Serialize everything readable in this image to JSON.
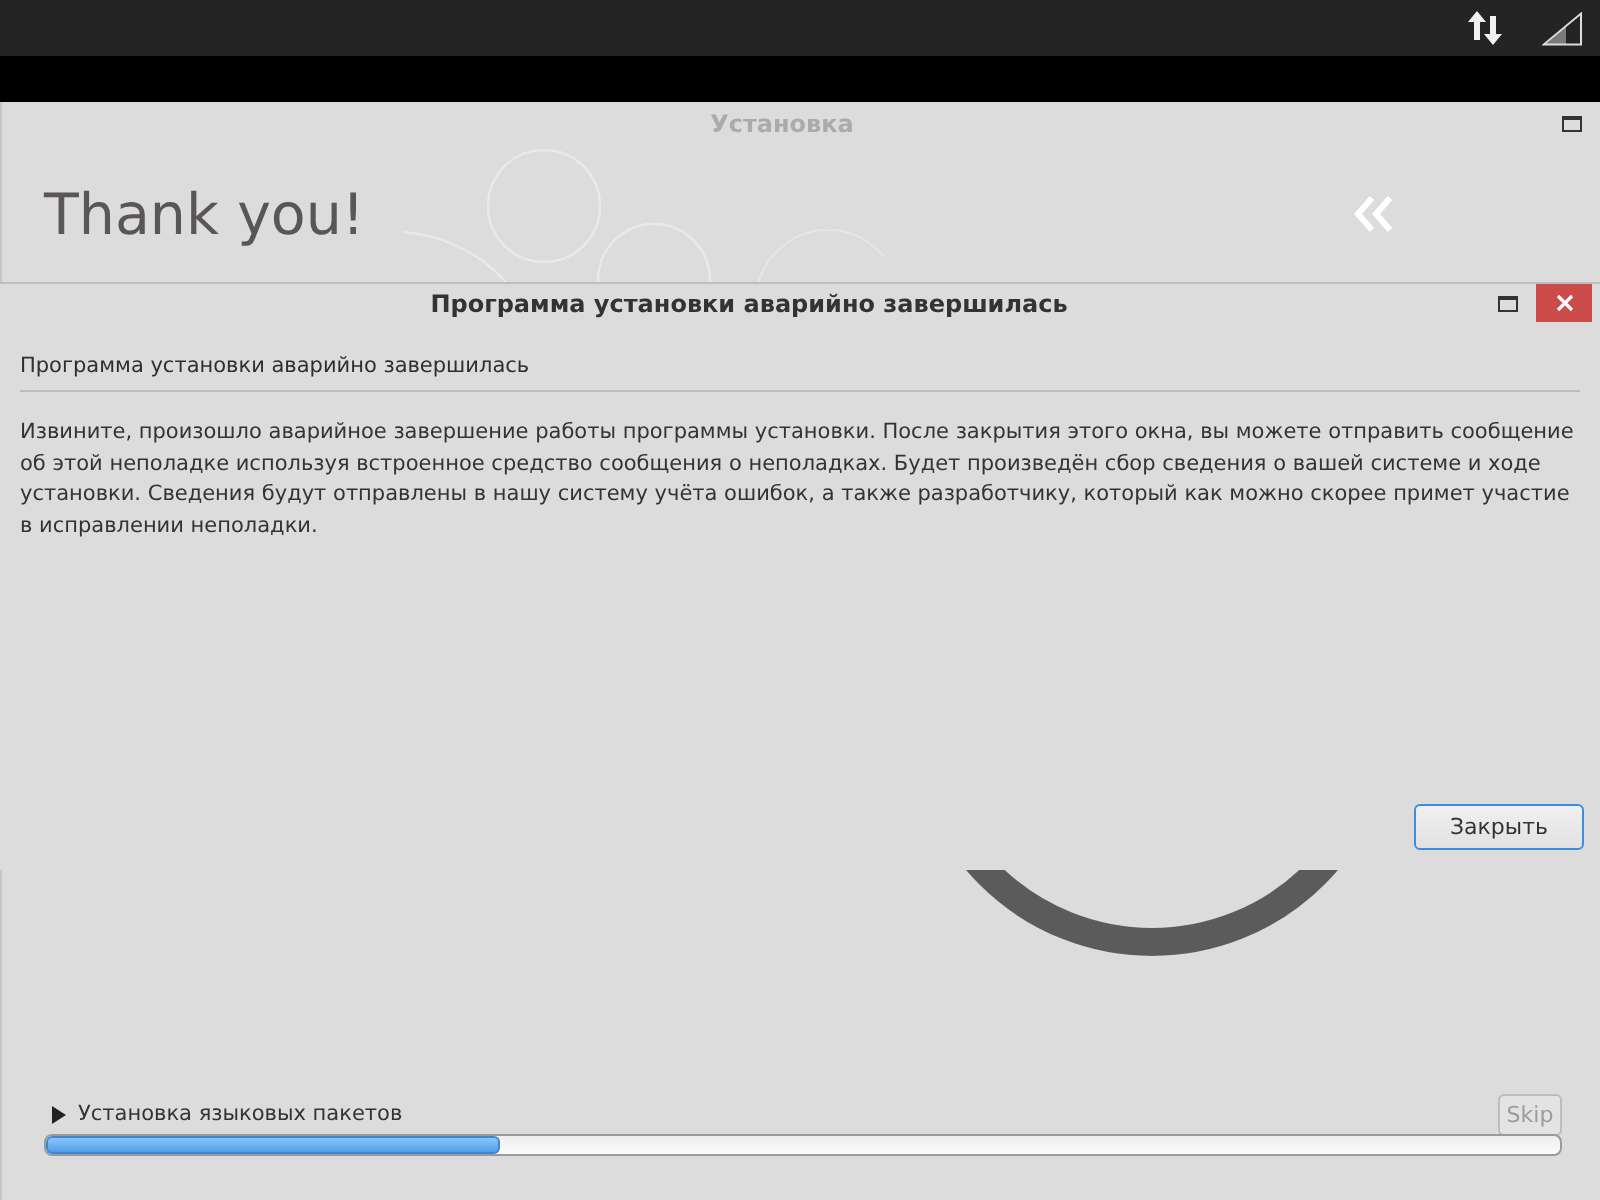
{
  "window": {
    "title": "Установка"
  },
  "header": {
    "heading": "Thank you!"
  },
  "dialog": {
    "title": "Программа установки аварийно завершилась",
    "summary": "Программа установки аварийно завершилась",
    "message": "Извините, произошло аварийное завершение работы программы установки. После закрытия этого окна, вы можете отправить сообщение об этой неполадке используя встроенное средство сообщения о неполадках. Будет произведён сбор сведения о вашей системе и ходе установки. Сведения будут отправлены в нашу систему учёта ошибок, а также разработчику, который как можно скорее примет участие в исправлении неполадки.",
    "buttons": [
      {
        "label": "Закрыть",
        "focused": true
      }
    ]
  },
  "footer": {
    "step": {
      "label": "Установка языковых пакетов",
      "expanded": false
    },
    "skip_button": {
      "label": "Skip",
      "disabled": true
    },
    "progress": {
      "level": 0.3
    }
  }
}
